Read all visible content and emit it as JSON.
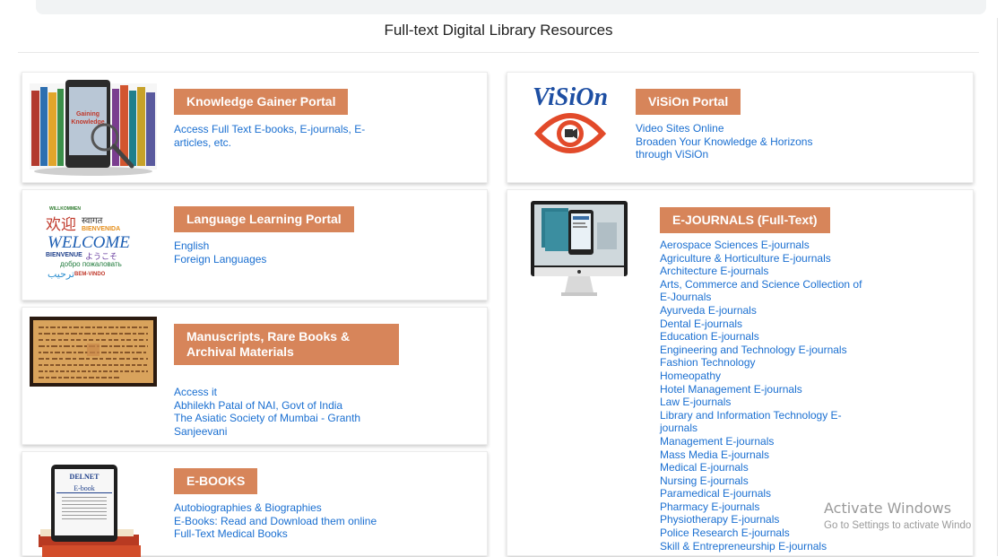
{
  "page": {
    "title": "Full-text Digital Library Resources"
  },
  "colors": {
    "heading_bg": "#d7855a",
    "link": "#1a6fd1"
  },
  "cards": {
    "knowledge": {
      "heading": "Knowledge Gainer Portal",
      "links": [
        "Access Full Text E-books, E-journals, E-",
        "articles, etc."
      ],
      "image_icon": "books-tablet-magnifier-icon",
      "image_text": [
        "Gaining",
        "Knowledge"
      ]
    },
    "vision": {
      "heading": "ViSiOn Portal",
      "links": [
        "Video Sites Online",
        "Broaden Your Knowledge & Horizons",
        "through ViSiOn"
      ],
      "logo_text": "ViSiOn",
      "image_icon": "eye-camera-logo-icon"
    },
    "language": {
      "heading": "Language Learning Portal",
      "links": [
        "English",
        "Foreign Languages"
      ],
      "image_words": {
        "w1": "WILLKOMMEN",
        "w2": "欢迎",
        "w3": "स्वागत",
        "w4": "BIENVENIDA",
        "w5": "WELCOME",
        "w6": "BIENVENUE",
        "w7": "ようこそ",
        "w8": "добро пожаловать",
        "w9": "ترحيب",
        "w10": "BEM-VINDO"
      }
    },
    "manuscripts": {
      "heading_line1": "Manuscripts, Rare Books &",
      "heading_line2": "Archival Materials",
      "links": [
        "Access it",
        "Abhilekh Patal of NAI, Govt of India",
        "The Asiatic Society of Mumbai - Granth",
        "Sanjeevani"
      ],
      "image_icon": "manuscript-page-icon"
    },
    "ebooks": {
      "heading": "E-BOOKS",
      "links": [
        "Autobiographies & Biographies",
        "E-Books: Read and Download them online",
        "Full-Text Medical Books"
      ],
      "image_brand": "DELNET",
      "image_label": "E-book"
    },
    "ejournals": {
      "heading": "E-JOURNALS (Full-Text)",
      "image_icon": "monitor-ejournal-icon",
      "links": [
        "Aerospace Sciences E-journals",
        "Agriculture & Horticulture E-journals",
        "Architecture E-journals",
        "Arts, Commerce and Science Collection of",
        "E-Journals",
        "Ayurveda E-journals",
        "Dental E-journals",
        "Education E-journals",
        "Engineering and Technology E-journals",
        "Fashion Technology",
        "Homeopathy",
        "Hotel Management E-journals",
        "Law E-journals",
        "Library and Information Technology E-",
        "journals",
        "Management E-journals",
        "Mass Media E-journals",
        "Medical E-journals",
        "Nursing E-journals",
        "Paramedical E-journals",
        "Pharmacy E-journals",
        "Physiotherapy E-journals",
        "Police Research E-journals",
        "Skill & Entrepreneurship E-journals"
      ]
    }
  },
  "watermark": {
    "line1": "Activate Windows",
    "line2": "Go to Settings to activate Windo"
  }
}
